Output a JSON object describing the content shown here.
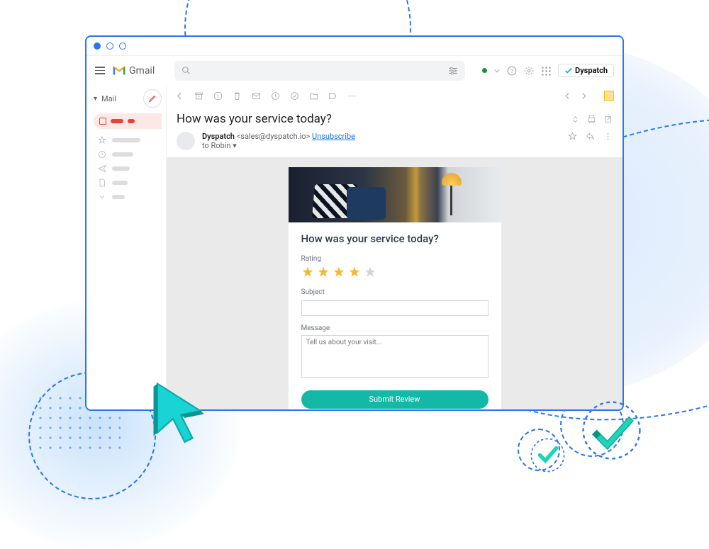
{
  "app": {
    "name": "Gmail",
    "badge": "Dyspatch"
  },
  "leftnav": {
    "mail_label": "Mail"
  },
  "email": {
    "subject": "How was your service today?",
    "sender_name": "Dyspatch",
    "sender_email": "<sales@dyspatch.io>",
    "unsubscribe": "Unsubscribe",
    "to_line": "to Robin"
  },
  "form": {
    "heading": "How was your service today?",
    "rating_label": "Rating",
    "rating_value": 4,
    "subject_label": "Subject",
    "message_label": "Message",
    "message_placeholder": "Tell us about your visit...",
    "submit_label": "Submit Review"
  },
  "colors": {
    "accent": "#14b8a6",
    "star": "#f5b82e",
    "blue": "#2876f5"
  }
}
